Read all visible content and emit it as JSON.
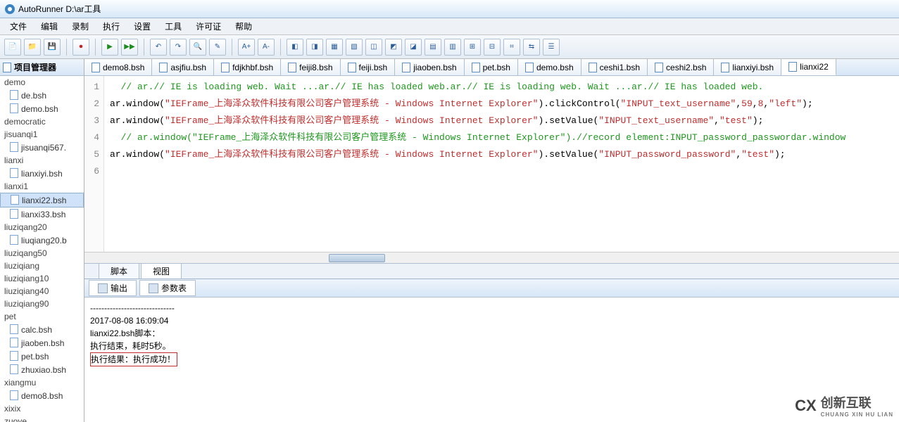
{
  "window": {
    "title": "AutoRunner  D:\\ar工具"
  },
  "menu": {
    "items": [
      "文件",
      "编辑",
      "录制",
      "执行",
      "设置",
      "工具",
      "许可证",
      "帮助"
    ]
  },
  "sidebar": {
    "title": "项目管理器",
    "tree": [
      {
        "type": "folder",
        "label": "demo"
      },
      {
        "type": "file",
        "label": "de.bsh"
      },
      {
        "type": "file",
        "label": "demo.bsh"
      },
      {
        "type": "folder",
        "label": "democratic"
      },
      {
        "type": "folder",
        "label": "jisuanqi1"
      },
      {
        "type": "file",
        "label": "jisuanqi567."
      },
      {
        "type": "folder",
        "label": "lianxi"
      },
      {
        "type": "file",
        "label": "lianxiyi.bsh"
      },
      {
        "type": "folder",
        "label": "lianxi1"
      },
      {
        "type": "file",
        "label": "lianxi22.bsh",
        "selected": true
      },
      {
        "type": "file",
        "label": "lianxi33.bsh"
      },
      {
        "type": "folder",
        "label": "liuziqang20"
      },
      {
        "type": "file",
        "label": "liuqiang20.b"
      },
      {
        "type": "folder",
        "label": "liuziqang50"
      },
      {
        "type": "folder",
        "label": "liuziqiang"
      },
      {
        "type": "folder",
        "label": "liuziqiang10"
      },
      {
        "type": "folder",
        "label": "liuziqiang40"
      },
      {
        "type": "folder",
        "label": "liuziqiang90"
      },
      {
        "type": "folder",
        "label": "pet"
      },
      {
        "type": "file",
        "label": "calc.bsh"
      },
      {
        "type": "file",
        "label": "jiaoben.bsh"
      },
      {
        "type": "file",
        "label": "pet.bsh"
      },
      {
        "type": "file",
        "label": "zhuxiao.bsh"
      },
      {
        "type": "folder",
        "label": "xiangmu"
      },
      {
        "type": "file",
        "label": "demo8.bsh"
      },
      {
        "type": "folder",
        "label": "xixix"
      },
      {
        "type": "folder",
        "label": "zuoye"
      }
    ]
  },
  "editor": {
    "tabs": [
      "demo8.bsh",
      "asjfiu.bsh",
      "fdjkhbf.bsh",
      "feiji8.bsh",
      "feiji.bsh",
      "jiaoben.bsh",
      "pet.bsh",
      "demo.bsh",
      "ceshi1.bsh",
      "ceshi2.bsh",
      "lianxiyi.bsh",
      "lianxi22"
    ],
    "activeTab": 11,
    "lines": [
      {
        "num": 1,
        "segments": [
          {
            "cls": "c-green",
            "text": "  // ar.// IE is loading web. Wait ...ar.// IE has loaded web.ar.// IE is loading web. Wait ...ar.// IE has loaded web."
          }
        ]
      },
      {
        "num": 2,
        "segments": [
          {
            "cls": "c-obj",
            "text": "ar."
          },
          {
            "cls": "c-kw",
            "text": "window"
          },
          {
            "cls": "c-obj",
            "text": "("
          },
          {
            "cls": "c-str",
            "text": "\"IEFrame_上海泽众软件科技有限公司客户管理系统 - Windows Internet Explorer\""
          },
          {
            "cls": "c-obj",
            "text": ")."
          },
          {
            "cls": "c-kw",
            "text": "clickControl"
          },
          {
            "cls": "c-obj",
            "text": "("
          },
          {
            "cls": "c-str",
            "text": "\"INPUT_text_username\""
          },
          {
            "cls": "c-obj",
            "text": ","
          },
          {
            "cls": "c-num",
            "text": "59"
          },
          {
            "cls": "c-obj",
            "text": ","
          },
          {
            "cls": "c-num",
            "text": "8"
          },
          {
            "cls": "c-obj",
            "text": ","
          },
          {
            "cls": "c-str",
            "text": "\"left\""
          },
          {
            "cls": "c-obj",
            "text": ");"
          }
        ]
      },
      {
        "num": 3,
        "segments": [
          {
            "cls": "c-obj",
            "text": "ar."
          },
          {
            "cls": "c-kw",
            "text": "window"
          },
          {
            "cls": "c-obj",
            "text": "("
          },
          {
            "cls": "c-str",
            "text": "\"IEFrame_上海泽众软件科技有限公司客户管理系统 - Windows Internet Explorer\""
          },
          {
            "cls": "c-obj",
            "text": ")."
          },
          {
            "cls": "c-kw",
            "text": "setValue"
          },
          {
            "cls": "c-obj",
            "text": "("
          },
          {
            "cls": "c-str",
            "text": "\"INPUT_text_username\""
          },
          {
            "cls": "c-obj",
            "text": ","
          },
          {
            "cls": "c-str",
            "text": "\"test\""
          },
          {
            "cls": "c-obj",
            "text": ");"
          }
        ]
      },
      {
        "num": 4,
        "segments": [
          {
            "cls": "c-green",
            "text": "  // ar.window(\"IEFrame_上海泽众软件科技有限公司客户管理系统 - Windows Internet Explorer\").//record element:INPUT_password_passwordar.window"
          }
        ]
      },
      {
        "num": 5,
        "segments": [
          {
            "cls": "c-obj",
            "text": "ar."
          },
          {
            "cls": "c-kw",
            "text": "window"
          },
          {
            "cls": "c-obj",
            "text": "("
          },
          {
            "cls": "c-str",
            "text": "\"IEFrame_上海泽众软件科技有限公司客户管理系统 - Windows Internet Explorer\""
          },
          {
            "cls": "c-obj",
            "text": ")."
          },
          {
            "cls": "c-kw",
            "text": "setValue"
          },
          {
            "cls": "c-obj",
            "text": "("
          },
          {
            "cls": "c-str",
            "text": "\"INPUT_password_password\""
          },
          {
            "cls": "c-obj",
            "text": ","
          },
          {
            "cls": "c-str",
            "text": "\"test\""
          },
          {
            "cls": "c-obj",
            "text": ");"
          }
        ]
      },
      {
        "num": 6,
        "segments": [
          {
            "cls": "",
            "text": ""
          }
        ]
      }
    ],
    "bottomTabs": {
      "labels": [
        "脚本",
        "视图"
      ],
      "active": 1
    }
  },
  "output": {
    "tabs": [
      "输出",
      "参数表"
    ],
    "activeTab": 0,
    "lines": [
      "------------------------------",
      "2017-08-08 16:09:04",
      "lianxi22.bsh脚本：",
      "执行结束，耗时5秒。"
    ],
    "resultLine": "执行结果：执行成功！"
  },
  "watermark": {
    "symbol": "CX",
    "text": "创新互联",
    "sub": "CHUANG XIN HU LIAN"
  }
}
